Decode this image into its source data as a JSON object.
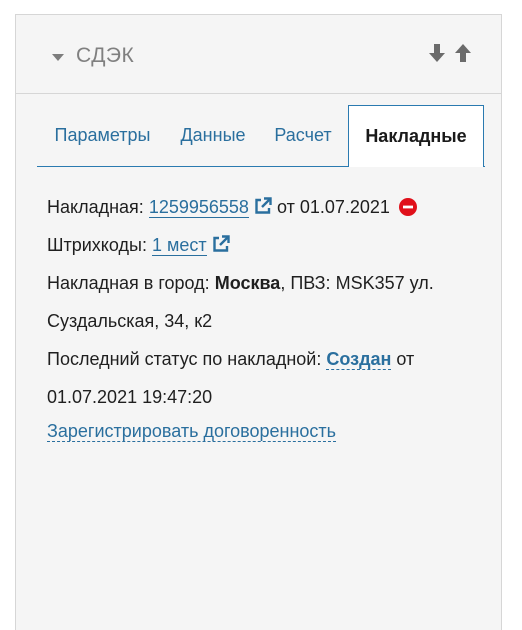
{
  "panel": {
    "title": "СДЭК",
    "icons": {
      "collapse": "caret-down-icon",
      "move_down": "arrow-down-icon",
      "move_up": "arrow-up-icon"
    }
  },
  "tabs": [
    {
      "label": "Параметры",
      "active": false
    },
    {
      "label": "Данные",
      "active": false
    },
    {
      "label": "Расчет",
      "active": false
    },
    {
      "label": "Накладные",
      "active": true
    }
  ],
  "invoice": {
    "label": "Накладная:",
    "number": "1259956558",
    "date_prefix": "от",
    "date": "01.07.2021"
  },
  "barcodes": {
    "label": "Штрихкоды:",
    "value": "1 мест"
  },
  "destination": {
    "label": "Накладная в город:",
    "city": "Москва",
    "pvz_label": ", ПВЗ:",
    "pvz_value": "MSK357 ул.",
    "pvz_value_cont": "Суздальская, 34, к2"
  },
  "status": {
    "label": "Последний статус по накладной:",
    "value": "Создан",
    "date_prefix": "от",
    "datetime": "01.07.2021 19:47:20"
  },
  "actions": {
    "register_agreement": "Зарегистрировать договоренность"
  },
  "colors": {
    "link": "#2a6f9e",
    "tab_border": "#2a7ab0",
    "panel_bg": "#f5f5f5",
    "danger": "#e0101a"
  }
}
